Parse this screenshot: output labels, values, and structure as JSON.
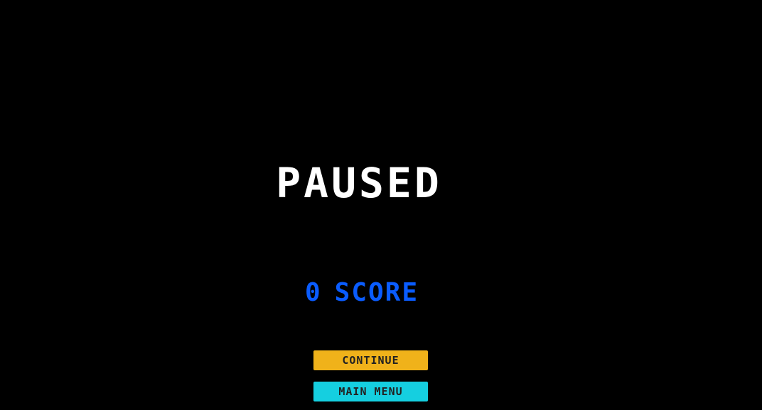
{
  "pause_screen": {
    "title": "PAUSED",
    "score_value": "0",
    "score_label": "SCORE",
    "continue_label": "CONTINUE",
    "main_menu_label": "MAIN MENU"
  },
  "colors": {
    "background": "#000000",
    "title": "#ffffff",
    "score": "#0a5cff",
    "continue_button": "#f0b21a",
    "main_menu_button": "#15cfe0"
  }
}
